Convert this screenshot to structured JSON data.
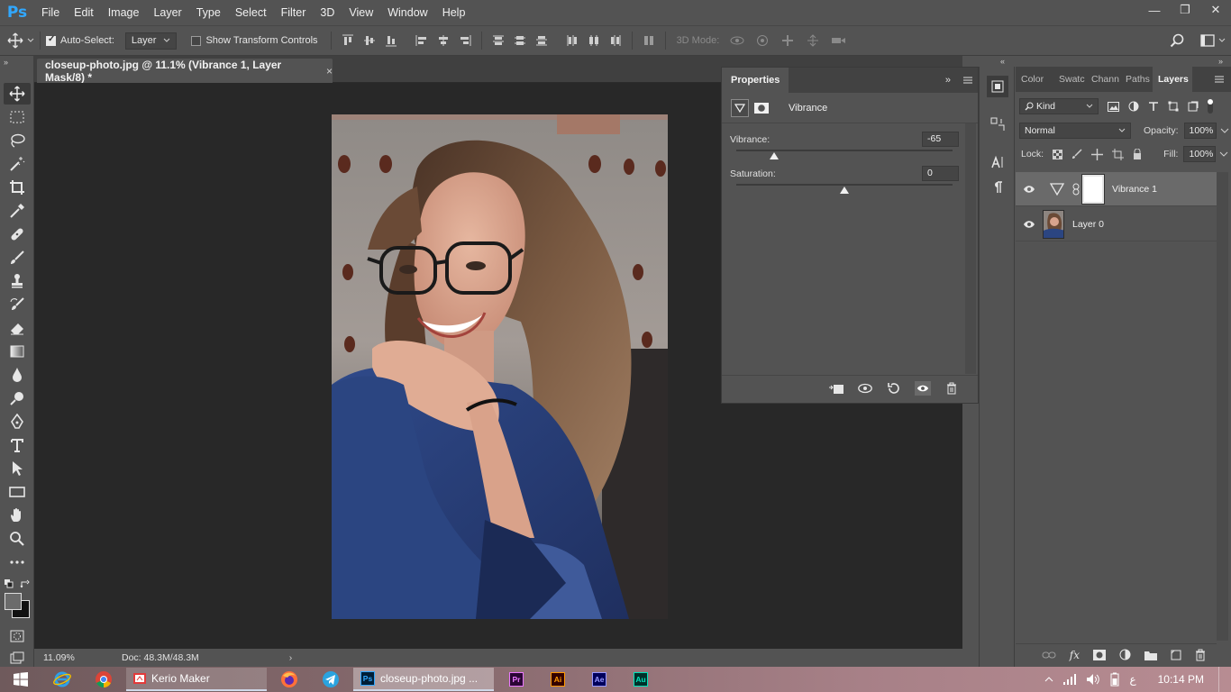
{
  "app": {
    "logo": "Ps",
    "accent": "#31a8ff"
  },
  "menu": [
    "File",
    "Edit",
    "Image",
    "Layer",
    "Type",
    "Select",
    "Filter",
    "3D",
    "View",
    "Window",
    "Help"
  ],
  "window_controls": {
    "minimize": "—",
    "restore": "❐",
    "close": "✕"
  },
  "options_bar": {
    "auto_select_label": "Auto-Select:",
    "auto_select_checked": true,
    "auto_select_target": "Layer",
    "show_transform_label": "Show Transform Controls",
    "show_transform_checked": false,
    "mode_3d_label": "3D Mode:"
  },
  "document": {
    "tab_title": "closeup-photo.jpg @ 11.1% (Vibrance 1, Layer Mask/8) *",
    "close_glyph": "×"
  },
  "status_bar": {
    "zoom": "11.09%",
    "doc_info": "Doc: 48.3M/48.3M",
    "arrow": "›"
  },
  "properties_panel": {
    "title": "Properties",
    "adjustment_title": "Vibrance",
    "vibrance_label": "Vibrance:",
    "vibrance_value": "-65",
    "vibrance_slider": -65,
    "saturation_label": "Saturation:",
    "saturation_value": "0",
    "saturation_slider": 0,
    "slider_range": [
      -100,
      100
    ]
  },
  "layers_panel": {
    "tabs": [
      "Color",
      "Swatc",
      "Chann",
      "Paths",
      "Layers"
    ],
    "active_tab": "Layers",
    "filter_kind": "Kind",
    "blend_mode": "Normal",
    "opacity_label": "Opacity:",
    "opacity_value": "100%",
    "lock_label": "Lock:",
    "fill_label": "Fill:",
    "fill_value": "100%",
    "layers": [
      {
        "name": "Vibrance 1",
        "selected": true,
        "type": "adjustment"
      },
      {
        "name": "Layer 0",
        "selected": false,
        "type": "image"
      }
    ]
  },
  "taskbar": {
    "apps": [
      {
        "name": "Kerio Maker",
        "icon": "kerio-icon"
      },
      {
        "name": "closeup-photo.jpg ...",
        "icon": "photoshop-icon"
      }
    ],
    "pinned": [
      {
        "label": "Pr",
        "color": "#ea77ff",
        "bg": "#2a0634"
      },
      {
        "label": "Ai",
        "color": "#ff9a00",
        "bg": "#330000"
      },
      {
        "label": "Ae",
        "color": "#9999ff",
        "bg": "#00005b"
      },
      {
        "label": "Au",
        "color": "#00e4bb",
        "bg": "#00302a"
      }
    ],
    "tray_lang": "ع",
    "clock": "10:14 PM"
  }
}
